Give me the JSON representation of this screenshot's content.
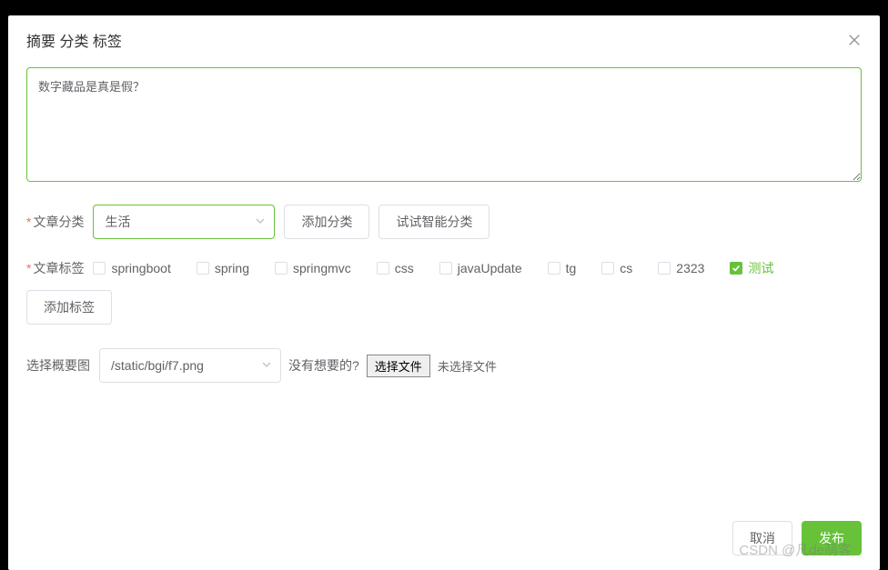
{
  "modal": {
    "title": "摘要 分类 标签"
  },
  "summary": {
    "value": "数字藏品是真是假？"
  },
  "category": {
    "label": "文章分类",
    "selected": "生活",
    "add_button": "添加分类",
    "smart_button": "试试智能分类"
  },
  "tags": {
    "label": "文章标签",
    "items": [
      {
        "label": "springboot",
        "checked": false
      },
      {
        "label": "spring",
        "checked": false
      },
      {
        "label": "springmvc",
        "checked": false
      },
      {
        "label": "css",
        "checked": false
      },
      {
        "label": "javaUpdate",
        "checked": false
      },
      {
        "label": "tg",
        "checked": false
      },
      {
        "label": "cs",
        "checked": false
      },
      {
        "label": "2323",
        "checked": false
      },
      {
        "label": "测试",
        "checked": true
      }
    ],
    "add_button": "添加标签"
  },
  "thumbnail": {
    "label": "选择概要图",
    "selected": "/static/bgi/f7.png",
    "prompt": "没有想要的?",
    "choose_button": "选择文件",
    "status": "未选择文件"
  },
  "footer": {
    "cancel": "取消",
    "publish": "发布"
  },
  "watermark": "CSDN @凡de萌客"
}
